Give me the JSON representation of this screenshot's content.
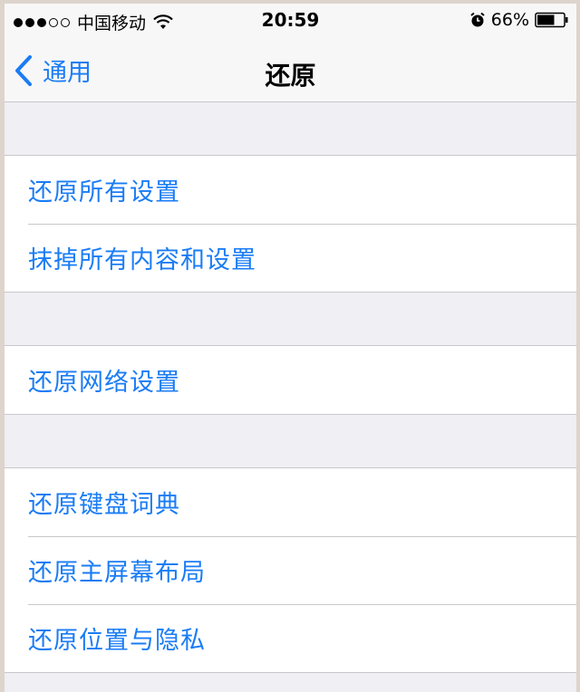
{
  "status_bar": {
    "carrier": "中国移动",
    "time": "20:59",
    "battery_percent": "66%",
    "battery_level": 0.66
  },
  "nav": {
    "back_label": "通用",
    "title": "还原"
  },
  "groups": [
    {
      "items": [
        {
          "label": "还原所有设置"
        },
        {
          "label": "抹掉所有内容和设置"
        }
      ]
    },
    {
      "items": [
        {
          "label": "还原网络设置"
        }
      ]
    },
    {
      "items": [
        {
          "label": "还原键盘词典"
        },
        {
          "label": "还原主屏幕布局"
        },
        {
          "label": "还原位置与隐私"
        }
      ]
    }
  ],
  "colors": {
    "accent": "#1a7cf5",
    "background": "#efeff4",
    "separator": "#c8c7cc"
  }
}
